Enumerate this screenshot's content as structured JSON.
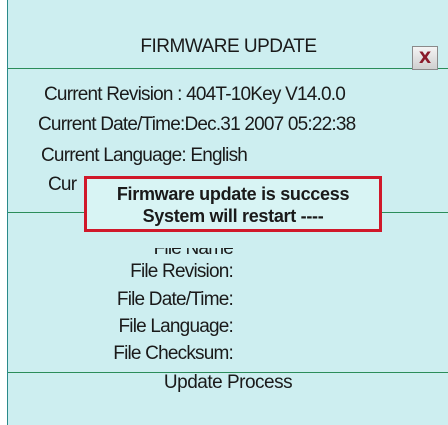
{
  "dialog": {
    "title": "FIRMWARE UPDATE",
    "close_label": "X"
  },
  "current": {
    "revision": "Current Revision : 404T-10Key V14.0.0",
    "datetime": "Current Date/Time:Dec.31 2007 05:22:38",
    "language": "Current Language: English",
    "partial": "Cur"
  },
  "file": {
    "name_partial": "File Name",
    "revision": "File Revision:",
    "datetime": "File Date/Time:",
    "language": "File Language:",
    "checksum": "File Checksum:"
  },
  "popup": {
    "line1": "Firmware update is success",
    "line2": "System will restart ----"
  },
  "process": {
    "label": "Update Process"
  },
  "colors": {
    "background": "#cdeef0",
    "divider": "#2b8d5a",
    "popup_border": "#d0182a"
  }
}
